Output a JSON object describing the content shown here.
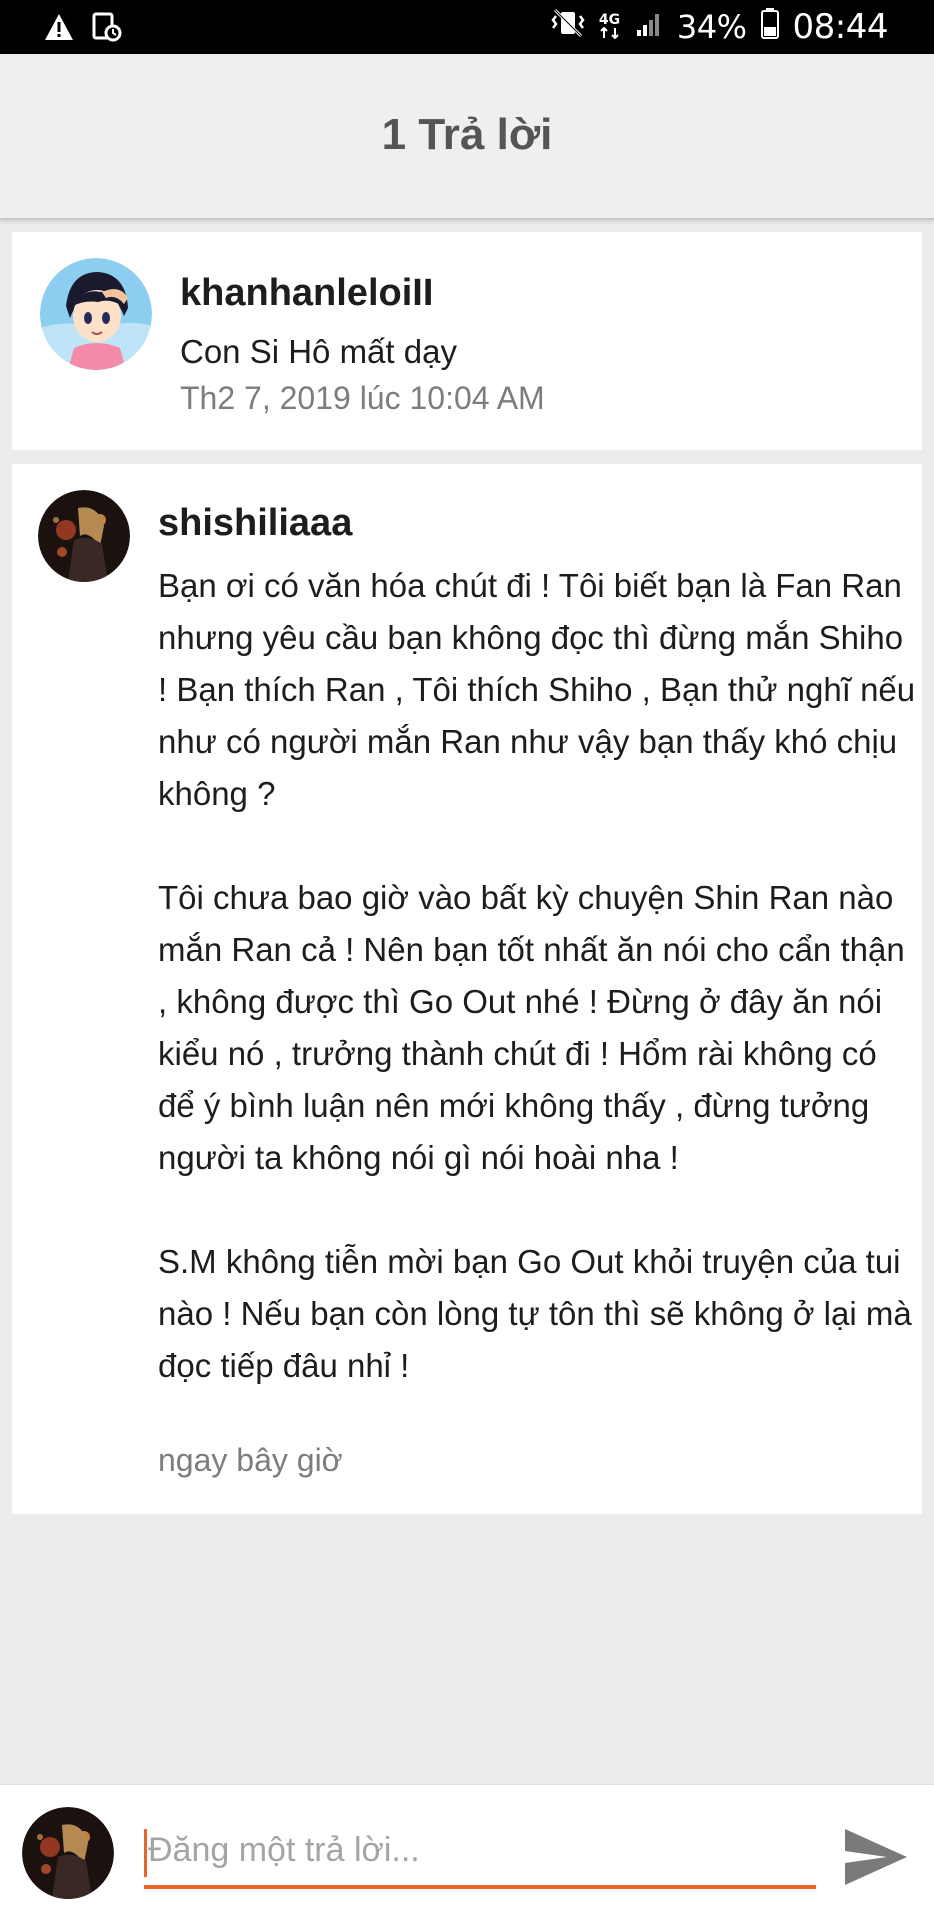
{
  "status_bar": {
    "network_label": "4G",
    "battery_percent": "34%",
    "time": "08:44",
    "icons": [
      "warning-icon",
      "image-clock-icon",
      "vibrate-icon",
      "network-4g-icon",
      "signal-icon",
      "battery-icon"
    ]
  },
  "header": {
    "title": "1 Trả lời"
  },
  "original_comment": {
    "username": "khanhanleloiII",
    "text": "Con Si Hô mất dạy",
    "timestamp": "Th2 7, 2019 lúc 10:04 AM"
  },
  "reply": {
    "username": "shishiliaaa",
    "paragraphs": [
      "Bạn ơi có văn hóa chút đi ! Tôi biết bạn là Fan Ran nhưng yêu cầu bạn không đọc thì đừng mắn Shiho ! Bạn thích Ran , Tôi thích Shiho , Bạn thử nghĩ nếu như có người mắn Ran như vậy bạn thấy khó chịu không ?",
      "Tôi chưa bao giờ vào bất kỳ chuyện Shin Ran nào mắn Ran cả ! Nên bạn tốt nhất ăn nói cho cẩn thận , không được thì Go Out nhé ! Đừng ở đây ăn nói kiểu nó , trưởng thành chút đi ! Hổm rài không có để ý bình luận nên mới không thấy , đừng tưởng người ta không nói gì nói hoài nha !",
      "S.M không tiễn mời bạn Go Out khỏi truyện của tui nào ! Nếu bạn còn lòng tự tôn thì sẽ không ở lại mà đọc tiếp đâu nhỉ !"
    ],
    "timestamp": "ngay bây giờ"
  },
  "composer": {
    "placeholder": "Đăng một trả lời...",
    "value": ""
  },
  "colors": {
    "accent": "#e8662c",
    "background": "#ececec",
    "card": "#ffffff",
    "status_bar": "#000000"
  }
}
